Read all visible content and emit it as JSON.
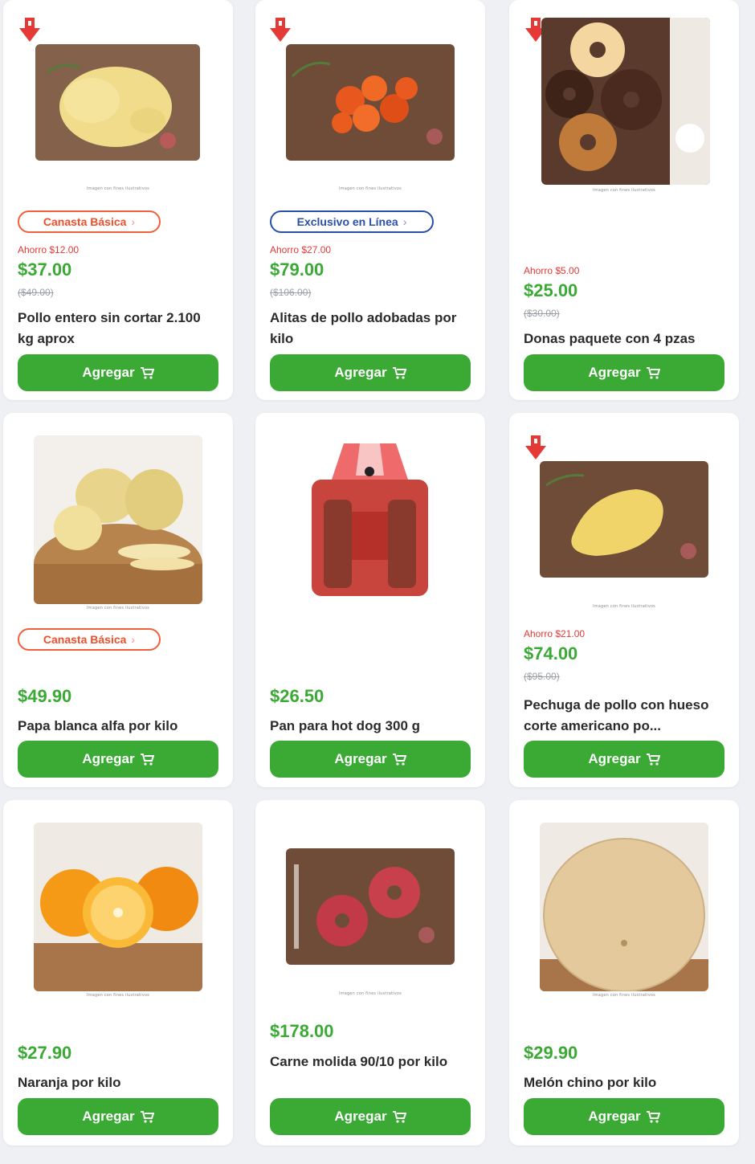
{
  "products": [
    {
      "name": "Pollo entero sin cortar 2.100 kg aprox",
      "badge": "Canasta Básica",
      "saving": "Ahorro $12.00",
      "price": "$37.00",
      "old_price": "($49.00)",
      "add_label": "Agregar"
    },
    {
      "name": "Alitas de pollo adobadas por kilo",
      "badge": "Exclusivo en Línea",
      "saving": "Ahorro $27.00",
      "price": "$79.00",
      "old_price": "($106.00)",
      "add_label": "Agregar"
    },
    {
      "name": "Donas paquete con 4 pzas",
      "saving": "Ahorro $5.00",
      "price": "$25.00",
      "old_price": "($30.00)",
      "add_label": "Agregar"
    },
    {
      "name": "Papa blanca alfa por kilo",
      "badge": "Canasta Básica",
      "price": "$49.90",
      "add_label": "Agregar"
    },
    {
      "name": "Pan para hot dog 300 g",
      "price": "$26.50",
      "add_label": "Agregar"
    },
    {
      "name": "Pechuga de pollo con hueso corte americano po...",
      "saving": "Ahorro $21.00",
      "price": "$74.00",
      "old_price": "($95.00)",
      "add_label": "Agregar"
    },
    {
      "name": "Naranja por kilo",
      "price": "$27.90",
      "add_label": "Agregar"
    },
    {
      "name": "Carne molida 90/10 por kilo",
      "price": "$178.00",
      "add_label": "Agregar"
    },
    {
      "name": "Melón chino por kilo",
      "price": "$29.90",
      "add_label": "Agregar"
    }
  ],
  "colors": {
    "price_green": "#3aaa35",
    "saving_red": "#e53935",
    "canasta_orange": "#f2603a",
    "exclusivo_blue": "#2a4fa8"
  },
  "icons": {
    "cart": "cart-icon",
    "discount": "red-down-arrow-icon"
  }
}
